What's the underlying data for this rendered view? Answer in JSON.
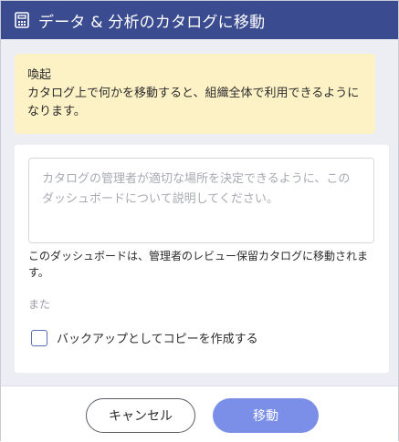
{
  "dialog": {
    "title": "データ & 分析のカタログに移動",
    "title_icon": "calculator-icon"
  },
  "notice": {
    "heading": "喚起",
    "body": "カタログ上で何かを移動すると、組織全体で利用できるようになります。"
  },
  "form": {
    "description_placeholder": "カタログの管理者が適切な場所を決定できるように、このダッシュボードについて説明してください。",
    "description_value": "",
    "move_note": "このダッシュボードは、管理者のレビュー保留カタログに移動されます。",
    "or_text": "また",
    "backup_label": "バックアップとしてコピーを作成する",
    "backup_checked": false
  },
  "footer": {
    "cancel_label": "キャンセル",
    "move_label": "移動"
  },
  "colors": {
    "header_bg": "#3b4b8f",
    "notice_bg": "#fdf1c6",
    "move_button_bg": "#7b8fe8",
    "checkbox_border": "#5b6fb5"
  }
}
